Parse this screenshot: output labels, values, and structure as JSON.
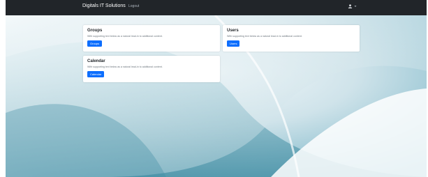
{
  "navbar": {
    "brand": "Digitals IT Solutions",
    "links": [
      "Logout"
    ],
    "user_menu_icon": "user-icon"
  },
  "cards": [
    {
      "title": "Groups",
      "text": "With supporting text below as a natural lead-in to additional content.",
      "button": "Groups"
    },
    {
      "title": "Users",
      "text": "With supporting text below as a natural lead-in to additional content.",
      "button": "Users"
    },
    {
      "title": "Calendar",
      "text": "With supporting text below as a natural lead-in to additional content.",
      "button": "Calendar"
    }
  ],
  "colors": {
    "navbar": "#212529",
    "primary": "#0d6efd",
    "background_accent": "#5aa3b8"
  }
}
